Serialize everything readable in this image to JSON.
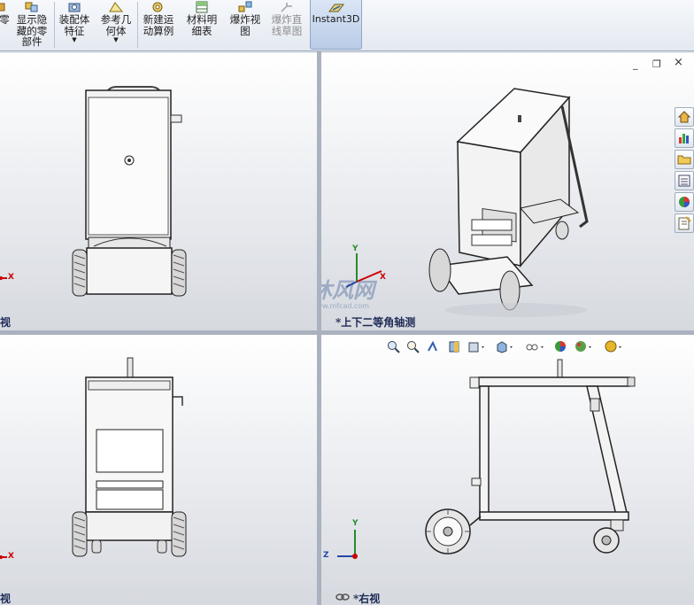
{
  "toolbar": {
    "items": [
      {
        "label": "零",
        "dim": false
      },
      {
        "label": "显示隐\n藏的零\n部件",
        "dim": false
      },
      {
        "label": "装配体\n特征",
        "dim": false,
        "dropdown": true
      },
      {
        "label": "参考几\n何体",
        "dim": false,
        "dropdown": true
      },
      {
        "label": "新建运\n动算例",
        "dim": false
      },
      {
        "label": "材料明\n细表",
        "dim": false
      },
      {
        "label": "爆炸视\n图",
        "dim": false
      },
      {
        "label": "爆炸直\n线草图",
        "dim": true
      }
    ],
    "instant3d": "Instant3D"
  },
  "viewports": {
    "top_left": {
      "label": "视"
    },
    "top_right": {
      "label": "*上下二等角轴测"
    },
    "bottom_left": {
      "label": "视"
    },
    "bottom_right": {
      "label": "*右视"
    }
  },
  "watermark": {
    "brand": "沐风网",
    "url": "www.mfcad.com"
  },
  "axes": {
    "x": "X",
    "y": "Y",
    "z": "Z"
  },
  "icons": {
    "task_pane": [
      "home-icon",
      "chart-icon",
      "folder-icon",
      "list-icon",
      "appearance-icon",
      "properties-icon"
    ],
    "heads_up": [
      "zoom-fit-icon",
      "zoom-area-icon",
      "previous-view-icon",
      "section-view-icon",
      "view-orientation-icon",
      "display-style-icon",
      "hide-show-icon",
      "edit-appearance-icon",
      "apply-scene-icon",
      "view-settings-icon"
    ]
  },
  "window_controls": {
    "minimize": "_",
    "restore": "❐",
    "close": "×"
  }
}
